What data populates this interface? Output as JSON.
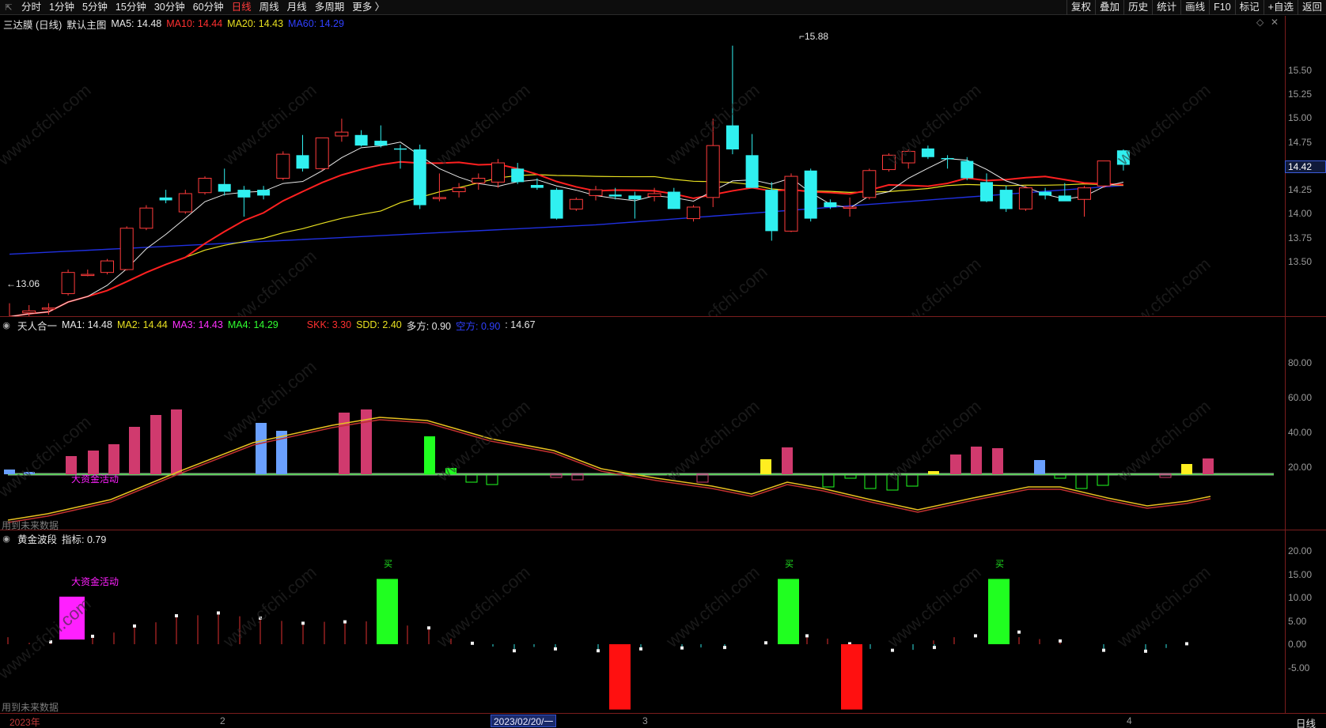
{
  "toolbar": {
    "corner_icon": "resize-icon",
    "periods": [
      "分时",
      "1分钟",
      "5分钟",
      "15分钟",
      "30分钟",
      "60分钟",
      "日线",
      "周线",
      "月线",
      "多周期",
      "更多 〉"
    ],
    "active_period": "日线",
    "right_buttons": [
      "复权",
      "叠加",
      "历史",
      "统计",
      "画线",
      "F10",
      "标记",
      "+自选",
      "返回"
    ]
  },
  "main_panel": {
    "stock_title": "三达膜 (日线)",
    "chart_name": "默认主图",
    "ma5": "MA5: 14.48",
    "ma10": "MA10: 14.44",
    "ma20": "MA20: 14.43",
    "ma60": "MA60: 14.29",
    "high_label": "15.88",
    "low_label": "13.06",
    "current_price": "14.42",
    "y_ticks": [
      "15.50",
      "15.25",
      "15.00",
      "14.75",
      "14.50",
      "14.25",
      "14.00",
      "13.75",
      "13.50"
    ]
  },
  "indicator1": {
    "name": "天人合一",
    "ma1": "MA1: 14.48",
    "ma2": "MA2: 14.44",
    "ma3": "MA3: 14.43",
    "ma4": "MA4: 14.29",
    "skk": "SKK: 3.30",
    "sdd": "SDD: 2.40",
    "long": "多方: 0.90",
    "short": "空方: 0.90",
    "extra": ": 14.67",
    "annotation": "大资金活动",
    "future_note": "用到未来数据",
    "y_ticks": [
      "80.00",
      "60.00",
      "40.00",
      "20.00"
    ]
  },
  "indicator2": {
    "name": "黄金波段",
    "value": "指标: 0.79",
    "annotation": "大资金活动",
    "buy_marker": "买",
    "future_note": "用到未来数据",
    "y_ticks": [
      "20.00",
      "15.00",
      "10.00",
      "5.00",
      "0.00",
      "-5.00"
    ]
  },
  "date_axis": {
    "labels": [
      "2023年",
      "2",
      "3",
      "4"
    ],
    "cursor_date": "2023/02/20/一",
    "period": "日线"
  },
  "colors": {
    "up": "#ff3b3b",
    "down": "#30f0f0",
    "ma5": "#e8e8e8",
    "ma10": "#ff2020",
    "ma20": "#e8e020",
    "ma60": "#2030e0",
    "magenta": "#ff20ff",
    "green": "#20ff20"
  },
  "chart_data": {
    "type": "candlestick",
    "candles": [
      [
        13.06,
        13.2,
        13.04,
        13.06
      ],
      [
        13.1,
        13.18,
        13.05,
        13.12
      ],
      [
        13.14,
        13.2,
        13.08,
        13.15
      ],
      [
        13.3,
        13.55,
        13.28,
        13.52
      ],
      [
        13.5,
        13.55,
        13.48,
        13.5
      ],
      [
        13.52,
        13.66,
        13.5,
        13.64
      ],
      [
        13.55,
        14.0,
        13.54,
        13.98
      ],
      [
        13.98,
        14.22,
        13.96,
        14.19
      ],
      [
        14.3,
        14.38,
        14.24,
        14.27
      ],
      [
        14.15,
        14.38,
        14.13,
        14.34
      ],
      [
        14.35,
        14.52,
        14.33,
        14.5
      ],
      [
        14.44,
        14.6,
        14.32,
        14.36
      ],
      [
        14.38,
        14.42,
        14.1,
        14.3
      ],
      [
        14.38,
        14.42,
        14.28,
        14.32
      ],
      [
        14.5,
        14.78,
        14.48,
        14.75
      ],
      [
        14.74,
        14.95,
        14.57,
        14.6
      ],
      [
        14.6,
        14.92,
        14.58,
        14.92
      ],
      [
        14.94,
        15.12,
        14.88,
        14.98
      ],
      [
        14.95,
        15.0,
        14.83,
        14.84
      ],
      [
        14.89,
        15.05,
        14.82,
        14.84
      ],
      [
        14.81,
        14.85,
        14.6,
        14.8
      ],
      [
        14.8,
        14.85,
        14.18,
        14.22
      ],
      [
        14.3,
        14.55,
        14.26,
        14.3
      ],
      [
        14.36,
        14.45,
        14.3,
        14.4
      ],
      [
        14.45,
        14.55,
        14.38,
        14.5
      ],
      [
        14.46,
        14.7,
        14.4,
        14.66
      ],
      [
        14.6,
        14.66,
        14.44,
        14.46
      ],
      [
        14.43,
        14.5,
        14.38,
        14.4
      ],
      [
        14.38,
        14.4,
        14.07,
        14.08
      ],
      [
        14.18,
        14.3,
        14.16,
        14.28
      ],
      [
        14.32,
        14.42,
        14.27,
        14.38
      ],
      [
        14.33,
        14.4,
        14.28,
        14.31
      ],
      [
        14.32,
        14.36,
        14.08,
        14.28
      ],
      [
        14.31,
        14.4,
        14.26,
        14.34
      ],
      [
        14.36,
        14.4,
        14.18,
        14.18
      ],
      [
        14.08,
        14.22,
        14.05,
        14.2
      ],
      [
        14.3,
        15.12,
        14.2,
        14.84
      ],
      [
        15.05,
        15.88,
        14.75,
        14.8
      ],
      [
        14.74,
        14.96,
        14.4,
        14.4
      ],
      [
        14.38,
        14.46,
        13.85,
        13.95
      ],
      [
        13.95,
        14.55,
        13.94,
        14.52
      ],
      [
        14.58,
        14.6,
        14.05,
        14.08
      ],
      [
        14.25,
        14.28,
        14.18,
        14.2
      ],
      [
        14.2,
        14.3,
        14.1,
        14.2
      ],
      [
        14.3,
        14.6,
        14.28,
        14.58
      ],
      [
        14.59,
        14.76,
        14.57,
        14.74
      ],
      [
        14.66,
        14.8,
        14.6,
        14.78
      ],
      [
        14.81,
        14.84,
        14.7,
        14.72
      ],
      [
        14.71,
        14.74,
        14.6,
        14.7
      ],
      [
        14.68,
        14.72,
        14.48,
        14.5
      ],
      [
        14.46,
        14.55,
        14.25,
        14.26
      ],
      [
        14.38,
        14.42,
        14.15,
        14.18
      ],
      [
        14.18,
        14.42,
        14.16,
        14.4
      ],
      [
        14.36,
        14.4,
        14.28,
        14.32
      ],
      [
        14.32,
        14.45,
        14.28,
        14.26
      ],
      [
        14.28,
        14.42,
        14.1,
        14.4
      ],
      [
        14.42,
        14.62,
        14.4,
        14.68
      ],
      [
        14.79,
        14.8,
        14.58,
        14.64
      ]
    ]
  }
}
